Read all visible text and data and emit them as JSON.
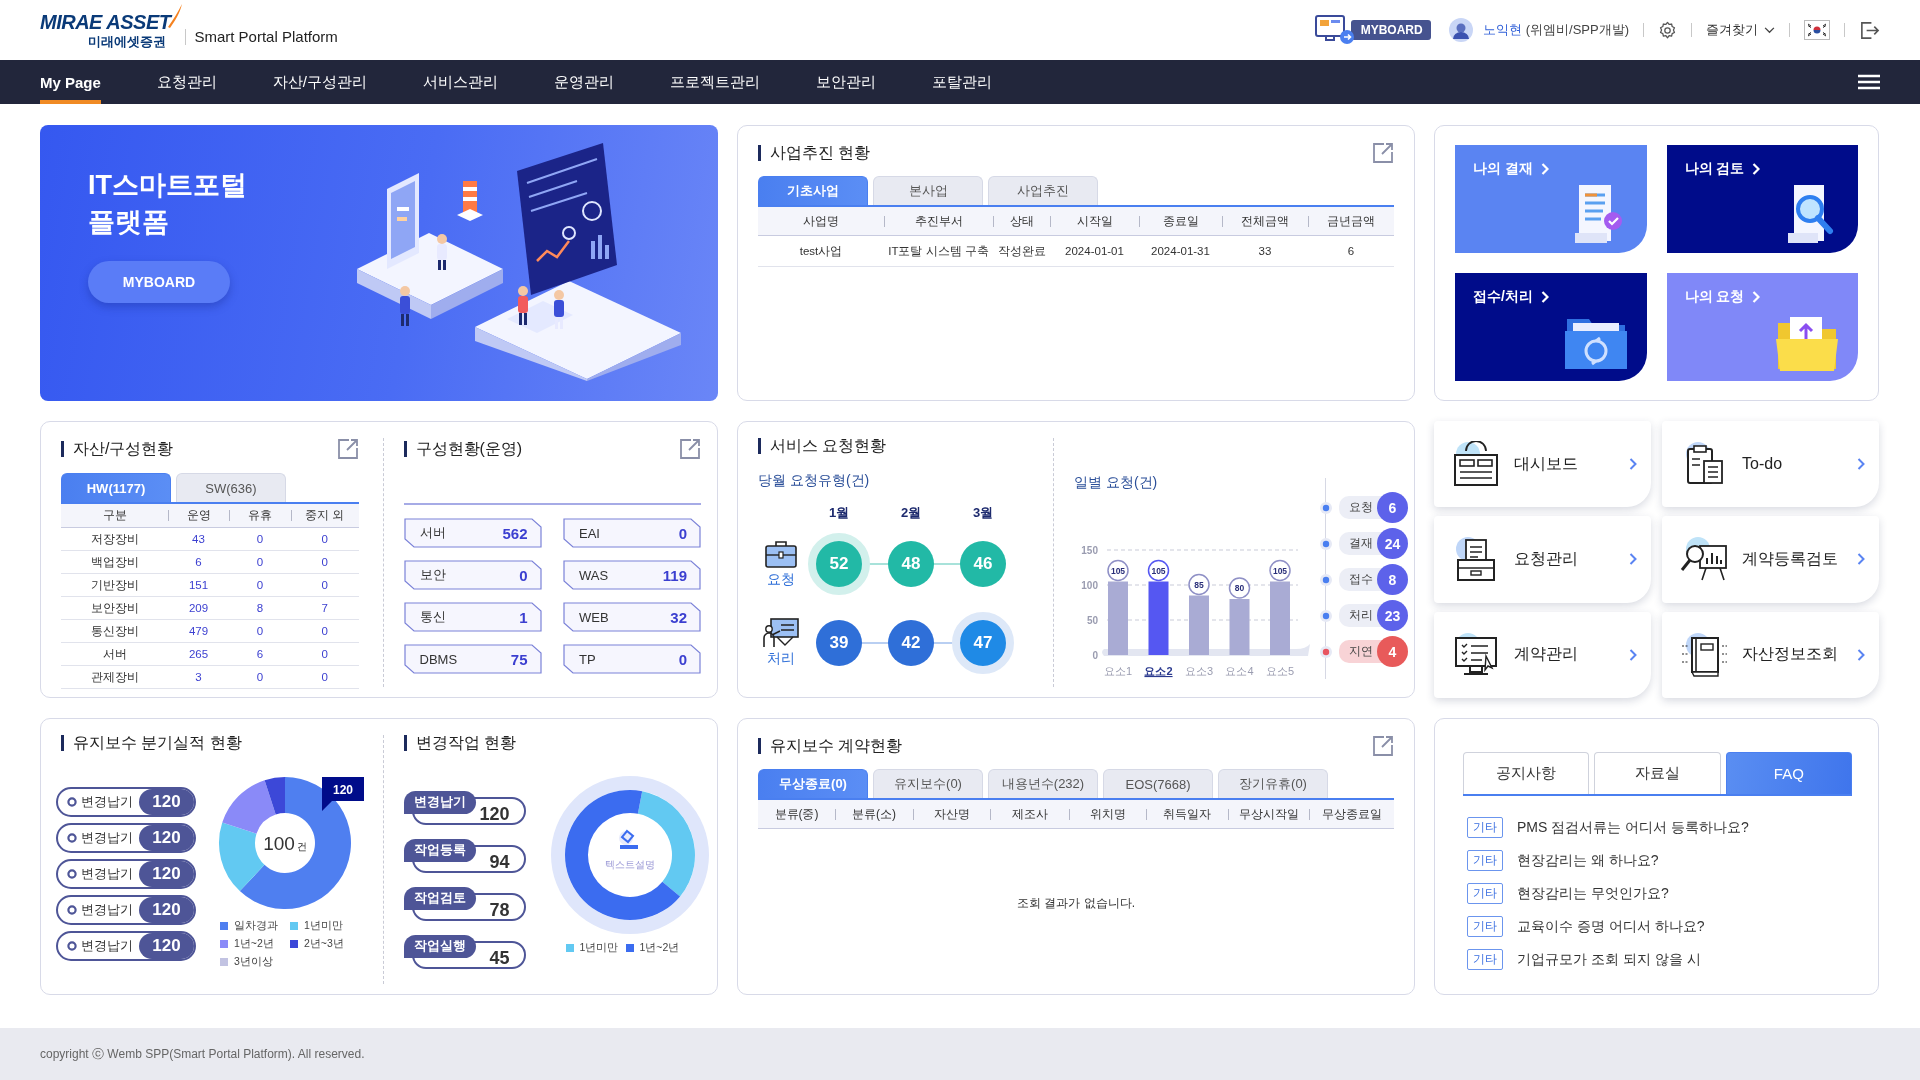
{
  "header": {
    "logo_title": "MIRAE ASSET",
    "logo_subtitle": "미래에셋증권",
    "platform_name": "Smart Portal Platform",
    "myboard_label": "MYBOARD",
    "user_name": "노익현",
    "user_org": "(위엠비/SPP개발)",
    "favorites_label": "즐겨찾기"
  },
  "nav": {
    "items": [
      {
        "label": "My Page",
        "selected": true
      },
      {
        "label": "요청관리",
        "selected": false
      },
      {
        "label": "자산/구성관리",
        "selected": false
      },
      {
        "label": "서비스관리",
        "selected": false
      },
      {
        "label": "운영관리",
        "selected": false
      },
      {
        "label": "프로젝트관리",
        "selected": false
      },
      {
        "label": "보안관리",
        "selected": false
      },
      {
        "label": "포탈관리",
        "selected": false
      }
    ]
  },
  "banner": {
    "title_lines": [
      "IT스마트포털",
      "플랫폼"
    ],
    "button_label": "MYBOARD"
  },
  "business_status": {
    "title": "사업추진 현황",
    "tabs": [
      {
        "label": "기초사업",
        "selected": true
      },
      {
        "label": "본사업",
        "selected": false
      },
      {
        "label": "사업추진",
        "selected": false
      }
    ],
    "columns": [
      "사업명",
      "추진부서",
      "상태",
      "시작일",
      "종료일",
      "전체금액",
      "금년금액"
    ],
    "rows": [
      [
        "test사업",
        "IT포탈 시스템 구축",
        "작성완료",
        "2024-01-01",
        "2024-01-31",
        "33",
        "6"
      ]
    ]
  },
  "quick_menu": [
    {
      "label": "나의 결재",
      "kind": "approval",
      "color": "#5a84f2"
    },
    {
      "label": "나의 검토",
      "kind": "review",
      "color": "#000c8a"
    },
    {
      "label": "접수/처리",
      "kind": "process",
      "color": "#000c8a"
    },
    {
      "label": "나의 요청",
      "kind": "request",
      "color": "#8088f8"
    }
  ],
  "asset_status": {
    "title": "자산/구성현황",
    "tabs": [
      {
        "label": "HW(1177)",
        "selected": true
      },
      {
        "label": "SW(636)",
        "selected": false
      }
    ],
    "columns": [
      "구분",
      "운영",
      "유휴",
      "중지 외"
    ],
    "rows": [
      [
        "저장장비",
        "43",
        "0",
        "0"
      ],
      [
        "백업장비",
        "6",
        "0",
        "0"
      ],
      [
        "기반장비",
        "151",
        "0",
        "0"
      ],
      [
        "보안장비",
        "209",
        "8",
        "7"
      ],
      [
        "통신장비",
        "479",
        "0",
        "0"
      ],
      [
        "서버",
        "265",
        "6",
        "0"
      ],
      [
        "관제장비",
        "3",
        "0",
        "0"
      ]
    ]
  },
  "config_status": {
    "title": "구성현황(운영)",
    "items": [
      {
        "label": "서버",
        "value": "562"
      },
      {
        "label": "EAI",
        "value": "0"
      },
      {
        "label": "보안",
        "value": "0"
      },
      {
        "label": "WAS",
        "value": "119"
      },
      {
        "label": "통신",
        "value": "1"
      },
      {
        "label": "WEB",
        "value": "32"
      },
      {
        "label": "DBMS",
        "value": "75"
      },
      {
        "label": "TP",
        "value": "0"
      }
    ]
  },
  "service_requests": {
    "title": "서비스 요청현황",
    "monthly": {
      "title": "당월 요청유형(건)",
      "months": [
        "1월",
        "2월",
        "3월"
      ],
      "rows": [
        {
          "label": "요청",
          "kind": "request",
          "values": [
            {
              "value": "52",
              "selected": true
            },
            {
              "value": "48",
              "selected": false
            },
            {
              "value": "46",
              "selected": false
            }
          ]
        },
        {
          "label": "처리",
          "kind": "process",
          "values": [
            {
              "value": "39",
              "selected": false
            },
            {
              "value": "42",
              "selected": false
            },
            {
              "value": "47",
              "selected": true
            }
          ]
        }
      ]
    },
    "daily": {
      "title": "일별 요청(건)",
      "chart_data": {
        "type": "bar",
        "categories": [
          "요소1",
          "요소2",
          "요소3",
          "요소4",
          "요소5"
        ],
        "values": [
          105,
          105,
          85,
          80,
          105
        ],
        "ylim": [
          0,
          150
        ],
        "yticks": [
          0,
          50,
          100,
          150
        ],
        "data_labels": true
      },
      "bar_states": [
        {
          "selected": false
        },
        {
          "selected": true
        },
        {
          "selected": false
        },
        {
          "selected": false
        },
        {
          "selected": false
        }
      ]
    },
    "statuses": [
      {
        "label": "요청",
        "count": "6",
        "kind": "normal"
      },
      {
        "label": "결재",
        "count": "24",
        "kind": "normal"
      },
      {
        "label": "접수",
        "count": "8",
        "kind": "normal"
      },
      {
        "label": "처리",
        "count": "23",
        "kind": "normal"
      },
      {
        "label": "지연",
        "count": "4",
        "kind": "delay"
      }
    ]
  },
  "shortcuts": [
    {
      "label": "대시보드",
      "kind": "dashboard"
    },
    {
      "label": "To-do",
      "kind": "todo"
    },
    {
      "label": "요청관리",
      "kind": "request"
    },
    {
      "label": "계약등록검토",
      "kind": "contract-review"
    },
    {
      "label": "계약관리",
      "kind": "contract"
    },
    {
      "label": "자산정보조회",
      "kind": "asset"
    }
  ],
  "maintenance_quarterly": {
    "title": "유지보수 분기실적 현황",
    "items": [
      {
        "label": "변경납기",
        "value": "120"
      },
      {
        "label": "변경납기",
        "value": "120"
      },
      {
        "label": "변경납기",
        "value": "120"
      },
      {
        "label": "변경납기",
        "value": "120"
      },
      {
        "label": "변경납기",
        "value": "120"
      }
    ],
    "donut": {
      "center_value": "100",
      "center_unit": "건",
      "callout": "120",
      "legend": [
        {
          "label": "일차경과",
          "color": "#4f7ff0"
        },
        {
          "label": "1년미만",
          "color": "#62c9f2"
        },
        {
          "label": "1년~2년",
          "color": "#8a8af8"
        },
        {
          "label": "2년~3년",
          "color": "#3c48d8"
        },
        {
          "label": "3년이상",
          "color": "#c2c3e2"
        }
      ]
    }
  },
  "change_work": {
    "title": "변경작업 현황",
    "items": [
      {
        "label": "변경납기",
        "value": "120"
      },
      {
        "label": "작업등록",
        "value": "94"
      },
      {
        "label": "작업검토",
        "value": "78"
      },
      {
        "label": "작업실행",
        "value": "45"
      }
    ],
    "donut": {
      "caption": "텍스트설명",
      "legend": [
        {
          "label": "1년미만",
          "color": "#62c9f2"
        },
        {
          "label": "1년~2년",
          "color": "#3b6cf0"
        }
      ]
    }
  },
  "maintenance_contracts": {
    "title": "유지보수 계약현황",
    "tabs": [
      {
        "label": "무상종료(0)",
        "selected": true
      },
      {
        "label": "유지보수(0)",
        "selected": false
      },
      {
        "label": "내용년수(232)",
        "selected": false
      },
      {
        "label": "EOS(7668)",
        "selected": false
      },
      {
        "label": "장기유휴(0)",
        "selected": false
      }
    ],
    "columns": [
      "분류(중)",
      "분류(소)",
      "자산명",
      "제조사",
      "위치명",
      "취득일자",
      "무상시작일",
      "무상종료일"
    ],
    "empty_message": "조회 결과가 없습니다."
  },
  "board": {
    "tabs": [
      {
        "label": "공지사항",
        "selected": false
      },
      {
        "label": "자료실",
        "selected": false
      },
      {
        "label": "FAQ",
        "selected": true
      }
    ],
    "items": [
      {
        "tag": "기타",
        "text": "PMS 점검서류는 어디서 등록하나요?"
      },
      {
        "tag": "기타",
        "text": "현장감리는 왜 하나요?"
      },
      {
        "tag": "기타",
        "text": "현장감리는 무엇인가요?"
      },
      {
        "tag": "기타",
        "text": "교육이수 증명 어디서 하나요?"
      },
      {
        "tag": "기타",
        "text": "기업규모가 조회 되지 않을 시"
      }
    ]
  },
  "footer": {
    "copyright": "copyright ⓒ Wemb SPP(Smart Portal Platform). All reserved."
  }
}
